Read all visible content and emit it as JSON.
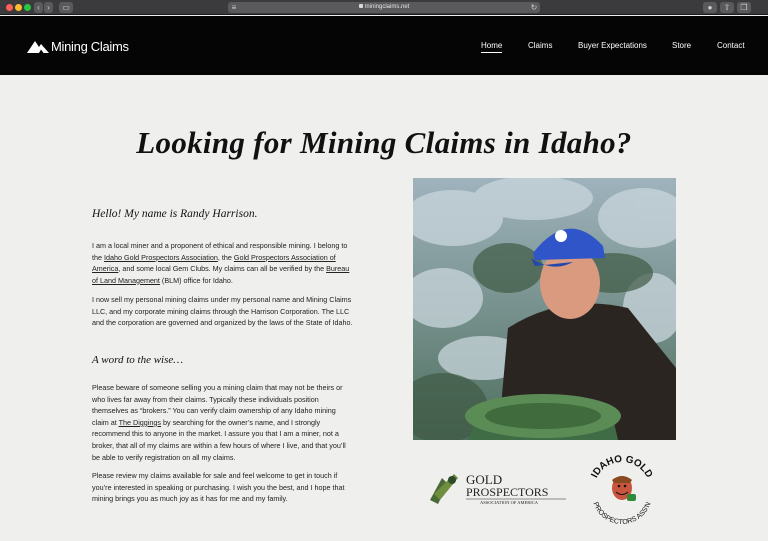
{
  "browser": {
    "url": "miningclaims.net"
  },
  "header": {
    "logo_text": "Mining Claims",
    "nav": [
      {
        "label": "Home",
        "active": true
      },
      {
        "label": "Claims",
        "active": false
      },
      {
        "label": "Buyer Expectations",
        "active": false
      },
      {
        "label": "Store",
        "active": false
      },
      {
        "label": "Contact",
        "active": false
      }
    ]
  },
  "main": {
    "title": "Looking for Mining Claims in Idaho?",
    "greeting": "Hello! My name is Randy Harrison.",
    "p1": {
      "t1": "I am a local miner and a proponent of ethical and responsible mining. I belong to the ",
      "link1": "Idaho Gold Prospectors Association",
      "t2": ", the ",
      "link2": "Gold Prospectors Association of America",
      "t3": ", and some local Gem Clubs. My claims can all be verified by the ",
      "link3": "Bureau of Land Management",
      "t4": " (BLM) office for Idaho."
    },
    "p2": "I now sell my personal mining claims under my personal name and Mining Claims LLC, and my corporate mining claims through the Harrison Corporation. The LLC and the corporation are governed and organized by the laws of the State of Idaho.",
    "subheading": "A word to the wise…",
    "p3": {
      "t1": "Please beware of someone selling you a mining claim that may not be theirs or who lives far away from their claims. Typically these individuals position themselves as “brokers.” You can verify claim ownership of any Idaho mining claim at ",
      "link1": "The Diggings",
      "t2": " by searching for the owner’s name, and I strongly recommend this to anyone in the market. I assure you that I am a miner, not a broker, that all of my claims are within a few hours of where I live, and that you’ll be able to verify registration on all my claims."
    },
    "p4": "Please review my claims available for sale and feel welcome to get in touch if you’re interested in speaking or purchasing. I wish you the best, and I hope that mining brings you as much joy as it has for me and my family."
  },
  "badges": {
    "gold_prospectors": {
      "line1": "GOLD",
      "line2": "PROSPECTORS",
      "line3": "ASSOCIATION OF AMERICA"
    },
    "idaho_gold": {
      "top": "IDAHO GOLD",
      "bottom": "PROSPECTORS ASS'N"
    }
  },
  "colors": {
    "header_bg": "#050505",
    "page_bg": "#efefed"
  }
}
